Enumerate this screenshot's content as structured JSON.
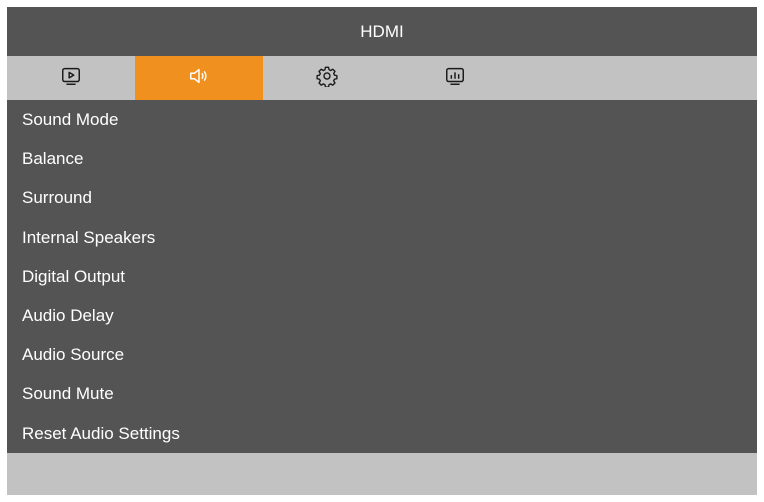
{
  "window": {
    "title": "HDMI"
  },
  "tabs": [
    {
      "icon": "play-icon",
      "active": false
    },
    {
      "icon": "speaker-icon",
      "active": true
    },
    {
      "icon": "gear-icon",
      "active": false
    },
    {
      "icon": "chart-icon",
      "active": false
    }
  ],
  "menu": {
    "items": [
      "Sound Mode",
      "Balance",
      "Surround",
      "Internal Speakers",
      "Digital Output",
      "Audio Delay",
      "Audio Source",
      "Sound Mute",
      "Reset Audio Settings"
    ]
  },
  "colors": {
    "accent": "#f0901e",
    "panel": "#545454",
    "bar": "#c2c2c2",
    "text": "#ffffff"
  }
}
